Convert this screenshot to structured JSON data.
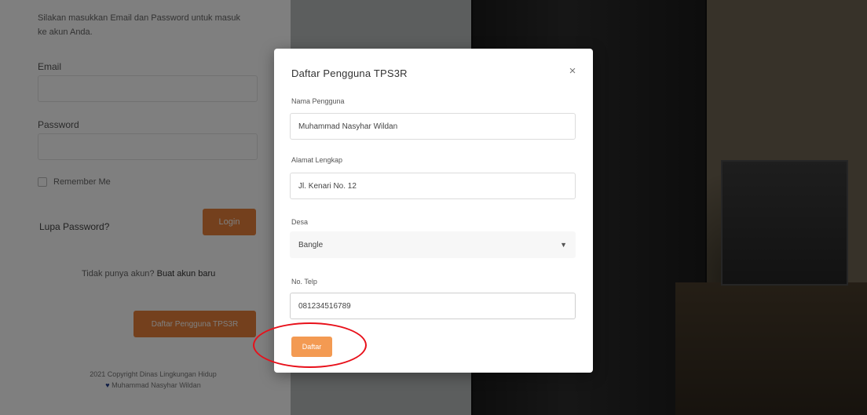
{
  "login": {
    "intro": "Silakan masukkan Email dan Password untuk masuk ke akun Anda.",
    "email_label": "Email",
    "password_label": "Password",
    "remember_label": "Remember Me",
    "forgot_label": "Lupa Password?",
    "login_button": "Login",
    "register_prompt": "Tidak punya akun?",
    "register_link": "Buat akun baru",
    "register_tps_button": "Daftar Pengguna TPS3R",
    "footer_line1": "2021 Copyright Dinas Lingkungan Hidup",
    "footer_line2": "Muhammad Nasyhar Wildan"
  },
  "modal": {
    "title": "Daftar Pengguna TPS3R",
    "close": "×",
    "fields": {
      "name": {
        "label": "Nama Pengguna",
        "value": "Muhammad Nasyhar Wildan"
      },
      "address": {
        "label": "Alamat Lengkap",
        "value": "Jl. Kenari No. 12"
      },
      "desa": {
        "label": "Desa",
        "value": "Bangle"
      },
      "phone": {
        "label": "No. Telp",
        "value": "081234516789"
      }
    },
    "submit_button": "Daftar"
  },
  "colors": {
    "accent": "#e8803a",
    "submit": "#f39a52",
    "annotation": "#e8101a"
  },
  "icons": {
    "close": "close-icon",
    "select": "chevron-down-icon",
    "heart": "heart-icon"
  }
}
